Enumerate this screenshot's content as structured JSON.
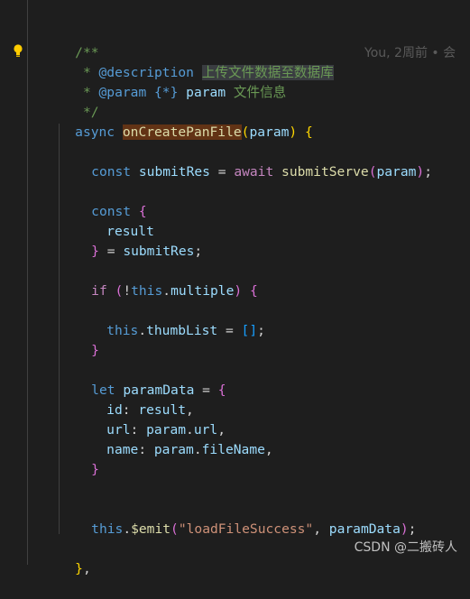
{
  "code": {
    "line1": "/**",
    "line2_prefix": " * ",
    "line2_tag": "@description",
    "line2_space": " ",
    "line2_text": "上传文件数据至数据库",
    "line3_prefix": " * ",
    "line3_tag": "@param",
    "line3_type": " {*} ",
    "line3_name": "param",
    "line3_text": " 文件信息",
    "line4": " */",
    "line5_async": "async ",
    "line5_fn": "onCreatePanFile",
    "line5_paren_open": "(",
    "line5_param": "param",
    "line5_paren_close": ")",
    "line5_brace": " {",
    "line7_const": "const ",
    "line7_var": "submitRes",
    "line7_eq": " = ",
    "line7_await": "await ",
    "line7_fn": "submitServe",
    "line7_paren_open": "(",
    "line7_arg": "param",
    "line7_paren_close": ")",
    "line7_semi": ";",
    "line9_const": "const ",
    "line9_brace": "{",
    "line10_var": "result",
    "line11_brace": "}",
    "line11_eq": " = ",
    "line11_var": "submitRes",
    "line11_semi": ";",
    "line13_if": "if ",
    "line13_paren_open": "(",
    "line13_bang": "!",
    "line13_this": "this",
    "line13_dot": ".",
    "line13_prop": "multiple",
    "line13_paren_close": ")",
    "line13_brace": " {",
    "line15_this": "this",
    "line15_dot": ".",
    "line15_prop": "thumbList",
    "line15_eq": " = ",
    "line15_arr": "[]",
    "line15_semi": ";",
    "line16_brace": "}",
    "line18_let": "let ",
    "line18_var": "paramData",
    "line18_eq": " = ",
    "line18_brace": "{",
    "line19_key": "id",
    "line19_colon": ": ",
    "line19_val": "result",
    "line19_comma": ",",
    "line20_key": "url",
    "line20_colon": ": ",
    "line20_obj": "param",
    "line20_dot": ".",
    "line20_prop": "url",
    "line20_comma": ",",
    "line21_key": "name",
    "line21_colon": ": ",
    "line21_obj": "param",
    "line21_dot": ".",
    "line21_prop": "fileName",
    "line21_comma": ",",
    "line22_brace": "}",
    "line25_this": "this",
    "line25_dot": ".",
    "line25_fn": "$emit",
    "line25_paren_open": "(",
    "line25_str": "\"loadFileSuccess\"",
    "line25_comma": ", ",
    "line25_arg": "paramData",
    "line25_paren_close": ")",
    "line25_semi": ";",
    "line27_brace": "}",
    "line27_comma": ","
  },
  "blame": "You, 2周前 • 会",
  "watermark": "CSDN @二搬砖人",
  "colors": {
    "background": "#1e1e1e",
    "comment": "#6a9955",
    "keyword": "#569cd6",
    "control": "#c586c0",
    "function": "#dcdcaa",
    "variable": "#9cdcfe",
    "string": "#ce9178",
    "bracket_gold": "#ffd700",
    "bracket_purple": "#da70d6",
    "bracket_blue": "#179fff"
  },
  "icons": {
    "gutter": "lightbulb-icon"
  }
}
